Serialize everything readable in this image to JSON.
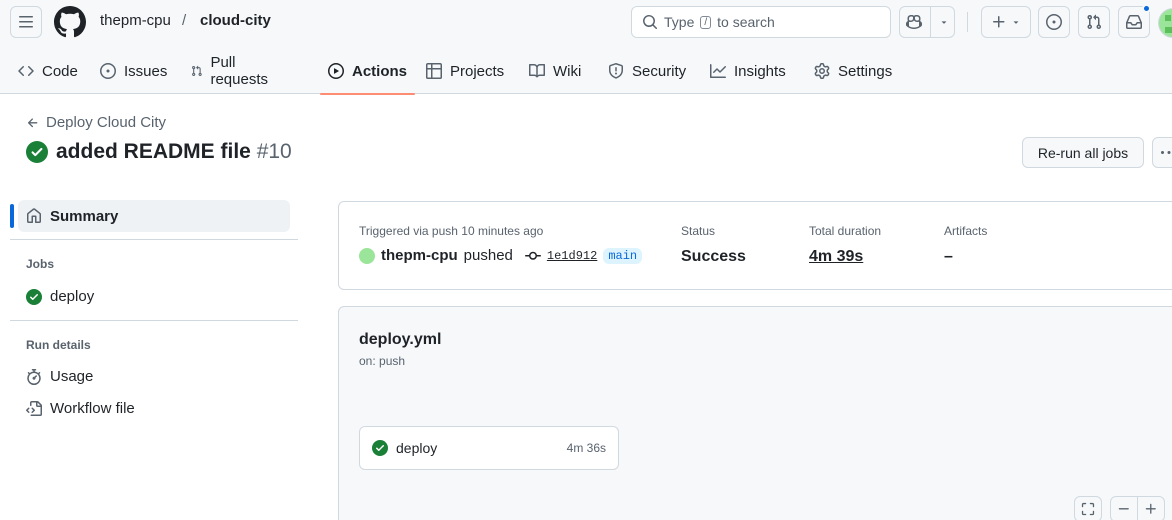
{
  "header": {
    "owner": "thepm-cpu",
    "separator": "/",
    "repo": "cloud-city",
    "search_prefix": "Type",
    "search_key": "/",
    "search_suffix": "to search",
    "plus_label": "+"
  },
  "tabs": [
    {
      "label": "Code",
      "icon": "code-icon"
    },
    {
      "label": "Issues",
      "icon": "issue-icon"
    },
    {
      "label": "Pull requests",
      "icon": "pull-request-icon"
    },
    {
      "label": "Actions",
      "icon": "play-icon",
      "active": true
    },
    {
      "label": "Projects",
      "icon": "table-icon"
    },
    {
      "label": "Wiki",
      "icon": "book-icon"
    },
    {
      "label": "Security",
      "icon": "shield-icon"
    },
    {
      "label": "Insights",
      "icon": "graph-icon"
    },
    {
      "label": "Settings",
      "icon": "gear-icon"
    }
  ],
  "run": {
    "back_label": "Deploy Cloud City",
    "title": "added README file",
    "number": "#10",
    "rerun_label": "Re-run all jobs"
  },
  "sidebar": {
    "summary_label": "Summary",
    "jobs_heading": "Jobs",
    "job_label": "deploy",
    "details_heading": "Run details",
    "usage_label": "Usage",
    "workflow_file_label": "Workflow file"
  },
  "summary": {
    "trigger_label": "Triggered via push 10 minutes ago",
    "actor": "thepm-cpu",
    "action": "pushed",
    "sha": "1e1d912",
    "branch": "main",
    "status_label": "Status",
    "status_value": "Success",
    "duration_label": "Total duration",
    "duration_value": "4m 39s",
    "artifacts_label": "Artifacts",
    "artifacts_value": "–"
  },
  "workflow": {
    "name": "deploy.yml",
    "on": "on: push",
    "job_name": "deploy",
    "job_time": "4m 36s"
  },
  "colors": {
    "success": "#1a7f37",
    "accent": "#0969da",
    "active_tab_underline": "#fd8c73"
  }
}
